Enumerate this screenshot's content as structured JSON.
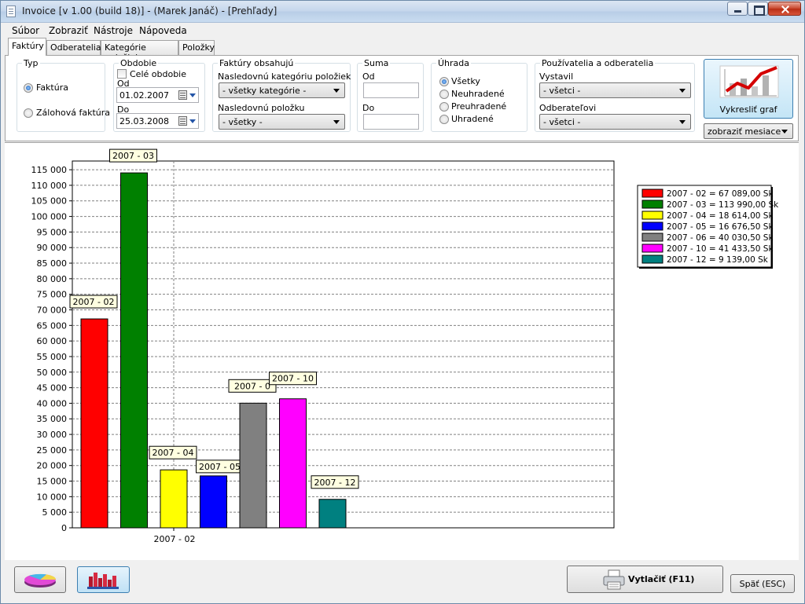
{
  "window": {
    "title": "Invoice [v 1.00 (build 18)]  -  (Marek Janáč) - [Prehľady]"
  },
  "menu": [
    "Súbor",
    "Zobraziť",
    "Nástroje",
    "Nápoveda"
  ],
  "tabs": [
    "Faktúry",
    "Odberatelia",
    "Kategórie položiek",
    "Položky"
  ],
  "filters": {
    "typ": {
      "label": "Typ",
      "options": [
        "Faktúra",
        "Zálohová faktúra"
      ]
    },
    "obdobie": {
      "label": "Obdobie",
      "whole_label": "Celé obdobie",
      "from_label": "Od",
      "from_value": "01.02.2007",
      "to_label": "Do",
      "to_value": "25.03.2008"
    },
    "obsahuju": {
      "label": "Faktúry obsahujú",
      "cat_label": "Nasledovnú kategóriu položiek",
      "cat_value": "- všetky kategórie -",
      "item_label": "Nasledovnú položku",
      "item_value": "- všetky -"
    },
    "suma": {
      "label": "Suma",
      "from_label": "Od",
      "to_label": "Do"
    },
    "uhrada": {
      "label": "Úhrada",
      "options": [
        "Všetky",
        "Neuhradené",
        "Preuhradené",
        "Uhradené"
      ]
    },
    "users": {
      "label": "Používatelia a odberatelia",
      "issued_label": "Vystavil",
      "issued_value": "- všetci -",
      "customer_label": "Odberateľovi",
      "customer_value": "- všetci -"
    },
    "draw_button": "Vykresliť graf",
    "period_select": "zobraziť mesiace"
  },
  "chart_data": {
    "type": "bar",
    "categories": [
      "2007 - 02",
      "2007 - 03",
      "2007 - 04",
      "2007 - 05",
      "2007 - 06",
      "2007 - 10",
      "2007 - 12"
    ],
    "values": [
      67089,
      113990,
      18614,
      16676.5,
      40030.5,
      41433.5,
      9139
    ],
    "colors": [
      "#ff0000",
      "#008000",
      "#ffff00",
      "#0000ff",
      "#808080",
      "#ff00ff",
      "#008080"
    ],
    "bar_labels": [
      "2007 - 02",
      "2007 - 03",
      "2007 - 04",
      "2007 - 05",
      "2007 - 0",
      "2007 - 10",
      "2007 - 12"
    ],
    "legend": [
      "2007 - 02 = 67 089,00 Sk",
      "2007 - 03 = 113 990,00 Sk",
      "2007 - 04 = 18 614,00 Sk",
      "2007 - 05 = 16 676,50 Sk",
      "2007 - 06 = 40 030,50 Sk",
      "2007 - 10 = 41 433,50 Sk",
      "2007 - 12 = 9 139,00 Sk"
    ],
    "y_ticks": [
      "115 000",
      "110 000",
      "105 000",
      "100 000",
      "95 000",
      "90 000",
      "85 000",
      "80 000",
      "75 000",
      "70 000",
      "65 000",
      "60 000",
      "55 000",
      "50 000",
      "45 000",
      "40 000",
      "35 000",
      "30 000",
      "25 000",
      "20 000",
      "15 000",
      "10 000",
      "5 000",
      "0"
    ],
    "x_label": "2007 - 02",
    "ylim": [
      0,
      115000
    ],
    "grid": true,
    "legend_position": "top-right"
  },
  "bottom": {
    "print_label": "Vytlačiť (F11)",
    "back_label": "Späť (ESC)"
  }
}
